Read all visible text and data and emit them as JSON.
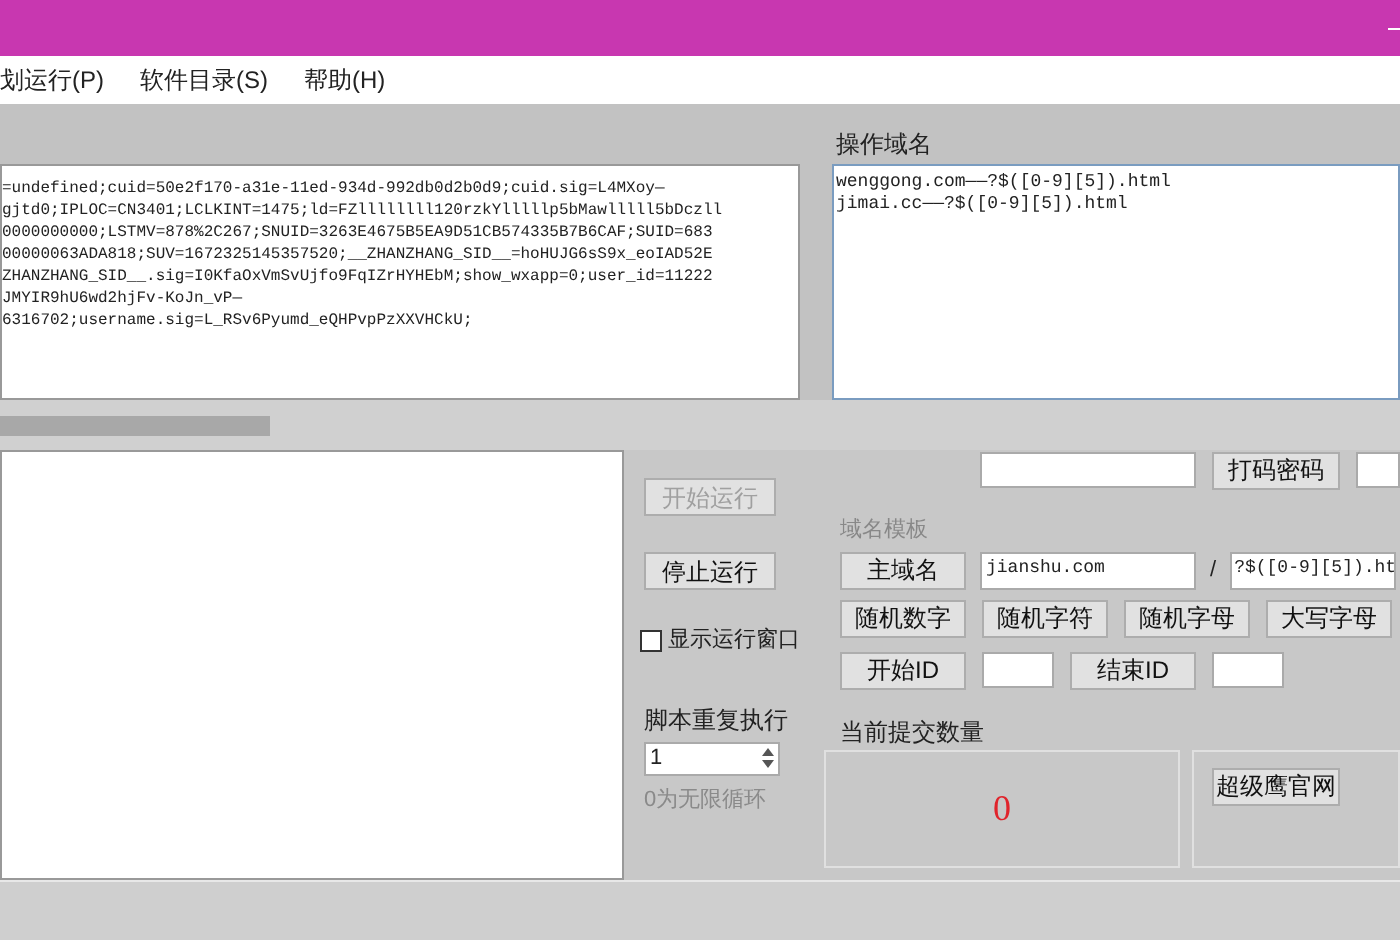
{
  "menu": [
    {
      "label": "划运行(P)"
    },
    {
      "label": "软件目录(S)"
    },
    {
      "label": "帮助(H)"
    }
  ],
  "cookie_text": [
    "=undefined;cuid=50e2f170-a31e-11ed-934d-992db0d2b0d9;cuid.sig=L4MXoy—",
    "gjtd0;IPLOC=CN3401;LCLKINT=1475;ld=FZllllllll120rzkYlllllp5bMawlllll5bDczll",
    "0000000000;LSTMV=878%2C267;SNUID=3263E4675B5EA9D51CB574335B7B6CAF;SUID=683",
    "00000063ADA818;SUV=1672325145357520;__ZHANZHANG_SID__=hoHUJG6sS9x_eoIAD52E",
    "ZHANZHANG_SID__.sig=I0KfaOxVmSvUjfo9FqIZrHYHEbM;show_wxapp=0;user_id=11222",
    "JMYIR9hU6wd2hjFv-KoJn_vP—",
    "6316702;username.sig=L_RSv6Pyumd_eQHPvpPzXXVHCkU;"
  ],
  "domains": {
    "label": "操作域名",
    "lines": [
      "wenggong.com——?$([0-9][5]).html",
      "jimai.cc——?$([0-9][5]).html"
    ]
  },
  "controls": {
    "start": {
      "label": "开始运行",
      "disabled": true
    },
    "stop": {
      "label": "停止运行",
      "disabled": false
    },
    "show_window": {
      "label": "显示运行窗口",
      "checked": false
    },
    "repeat_label": "脚本重复执行",
    "repeat_value": "1",
    "repeat_hint": "0为无限循环"
  },
  "captcha": {
    "button": "打码密码"
  },
  "template": {
    "label": "域名模板",
    "main_button": "主域名",
    "main_value": "jianshu.com",
    "separator": "/",
    "pattern_value": "?$([0-9][5]).ht",
    "buttons": [
      "随机数字",
      "随机字符",
      "随机字母",
      "大写字母"
    ],
    "start_id": "开始ID",
    "end_id": "结束ID"
  },
  "count": {
    "label": "当前提交数量",
    "value": "0"
  },
  "link_button": "超级鹰官网"
}
